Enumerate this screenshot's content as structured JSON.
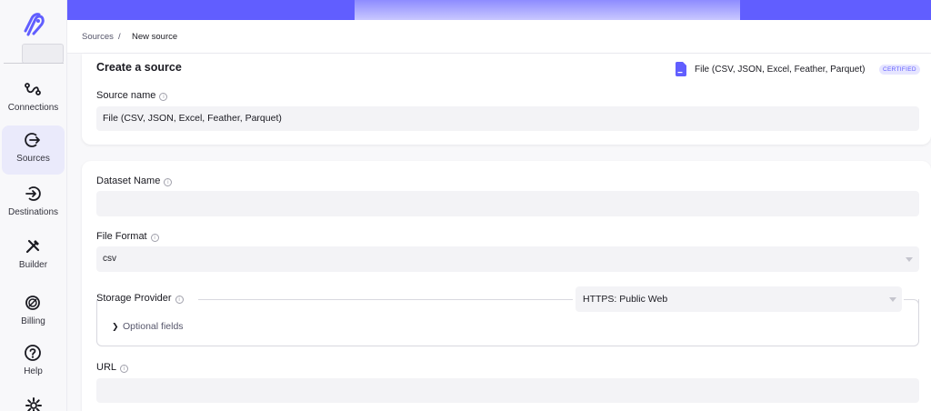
{
  "sidebar": {
    "items": [
      {
        "label": "Connections",
        "icon": "connections-icon"
      },
      {
        "label": "Sources",
        "icon": "sources-icon",
        "active": true
      },
      {
        "label": "Destinations",
        "icon": "destinations-icon"
      },
      {
        "label": "Builder",
        "icon": "builder-icon"
      },
      {
        "label": "Billing",
        "icon": "billing-icon"
      },
      {
        "label": "Help",
        "icon": "help-icon"
      }
    ]
  },
  "breadcrumb": {
    "parent": "Sources",
    "separator": "/",
    "current": "New source"
  },
  "create_card": {
    "title": "Create a source",
    "connector_name": "File (CSV, JSON, Excel, Feather, Parquet)",
    "badge": "CERTIFIED",
    "source_name_label": "Source name",
    "source_name_value": "File (CSV, JSON, Excel, Feather, Parquet)"
  },
  "config": {
    "dataset_name_label": "Dataset Name",
    "dataset_name_value": "",
    "file_format_label": "File Format",
    "file_format_value": "csv",
    "storage_provider_label": "Storage Provider",
    "storage_provider_value": "HTTPS: Public Web",
    "optional_fields_label": "Optional fields",
    "url_label": "URL",
    "url_value": ""
  },
  "colors": {
    "accent": "#615eff",
    "badge_bg": "#e6e5ff",
    "input_bg": "#f3f3f6"
  }
}
